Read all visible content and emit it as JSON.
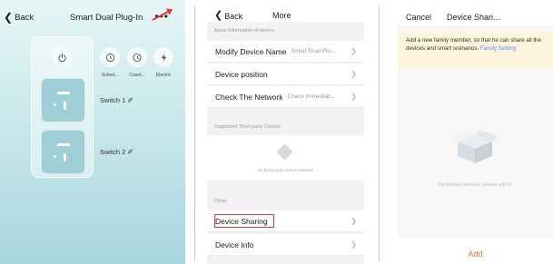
{
  "screen1": {
    "back_label": "Back",
    "title": "Smart Dual Plug-In",
    "more_icon": "ellipsis-icon",
    "controls": [
      {
        "label": "Sched...",
        "icon": "clock-icon"
      },
      {
        "label": "Count...",
        "icon": "countdown-icon"
      },
      {
        "label": "Electric",
        "icon": "bolt-icon"
      }
    ],
    "switches": [
      {
        "label": "Switch 1 ✐"
      },
      {
        "label": "Switch 2 ✐"
      }
    ]
  },
  "screen2": {
    "back_label": "Back",
    "title": "More",
    "section_basic": "Basic Information of device",
    "modify_name": {
      "label": "Modify Device Name",
      "value": "Smart Dual Plu..."
    },
    "position": {
      "label": "Device position"
    },
    "network": {
      "label": "Check The Network",
      "value": "Check immediat..."
    },
    "section_third": "Supported Third-party Control",
    "third_empty": "No third-party control available",
    "section_other": "Other",
    "sharing": {
      "label": "Device Sharing"
    },
    "info": {
      "label": "Device Info"
    }
  },
  "screen3": {
    "cancel_label": "Cancel",
    "title": "Device Shari...",
    "notice_text": "Add a new family member, so that he can share all the devices and smart scenarios.",
    "notice_link": "Family Setting",
    "empty_text": "No shared devices, please add it.",
    "add_label": "Add"
  },
  "colors": {
    "accent_red": "#e53935",
    "link_blue": "#4a8ff2",
    "add_orange": "#f26d3a",
    "teal_bg": "#c3e5ea"
  }
}
